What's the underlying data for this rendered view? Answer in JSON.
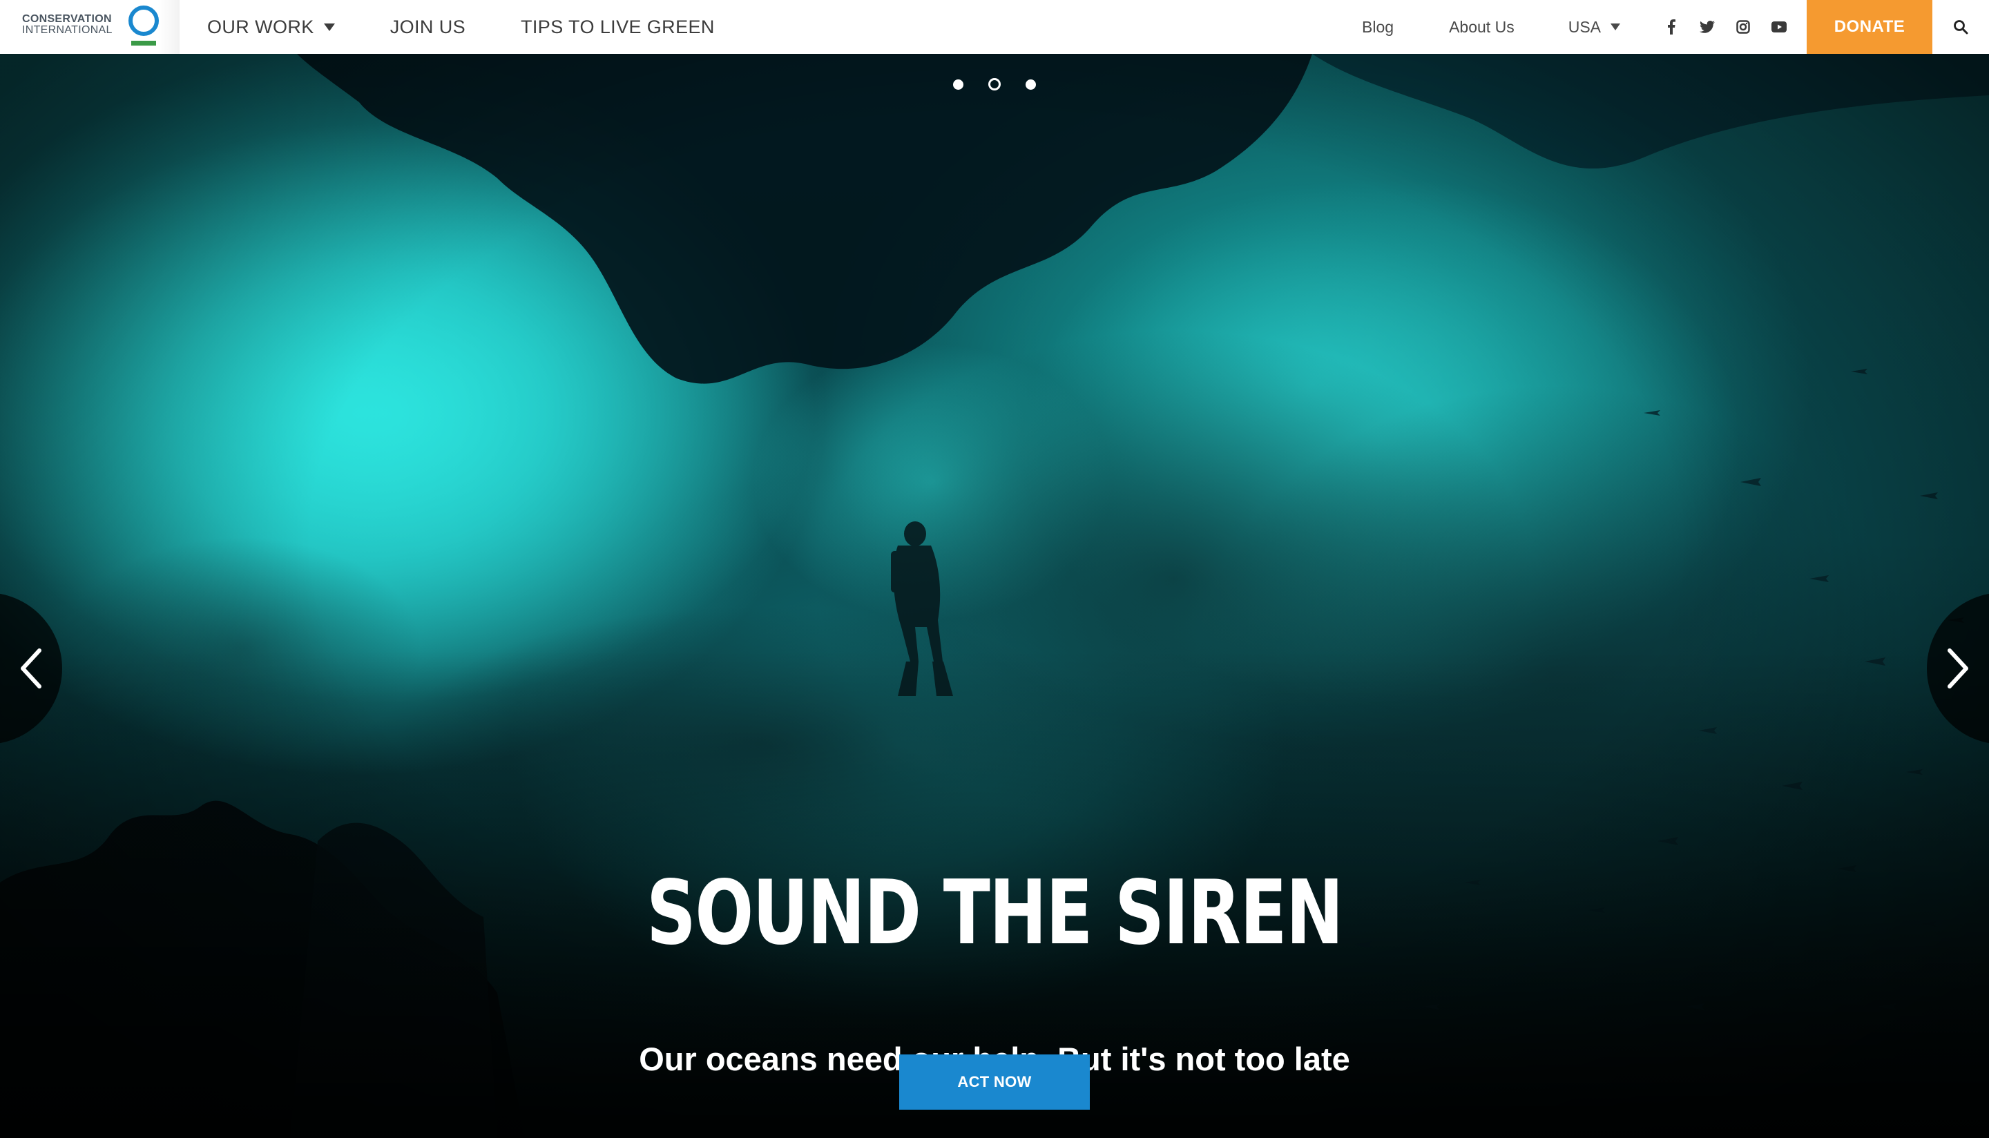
{
  "brand": {
    "name_line1": "CONSERVATION",
    "name_line2": "INTERNATIONAL",
    "ring_color": "#1a88cf",
    "bar_color": "#3a9a47"
  },
  "nav": {
    "main_items": [
      {
        "label": "OUR WORK",
        "has_dropdown": true
      },
      {
        "label": "JOIN US",
        "has_dropdown": false
      },
      {
        "label": "TIPS TO LIVE GREEN",
        "has_dropdown": false
      }
    ],
    "blog_label": "Blog",
    "about_label": "About Us",
    "country_label": "USA",
    "social_icons": [
      "facebook-icon",
      "twitter-icon",
      "instagram-icon",
      "youtube-icon"
    ],
    "donate_label": "DONATE",
    "donate_color": "#f59a30",
    "search_icon": "search-icon"
  },
  "hero": {
    "slides": 3,
    "active_slide": 2,
    "title": "SOUND THE SIREN",
    "subtitle": "Our oceans need our help. But it's not too late",
    "cta_label": "ACT NOW",
    "cta_color": "#1a88cf",
    "prev_icon": "chevron-left-icon",
    "next_icon": "chevron-right-icon"
  }
}
